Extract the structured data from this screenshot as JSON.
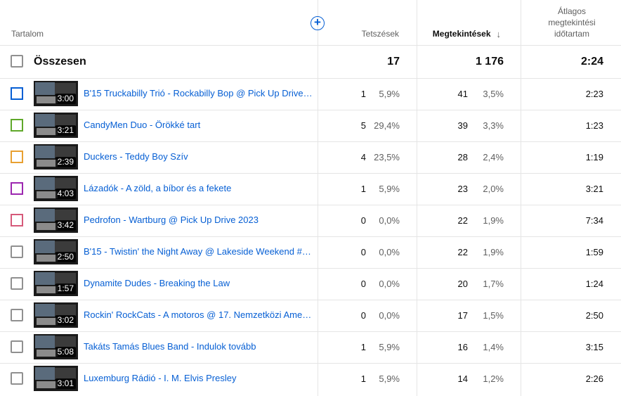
{
  "header": {
    "content": "Tartalom",
    "likes": "Tetszések",
    "views": "Megtekintések",
    "avg_line1": "Átlagos",
    "avg_line2": "megtekintési",
    "avg_line3": "időtartam",
    "add_icon": "plus-circle-icon",
    "sort_icon": "arrow-down-icon"
  },
  "total": {
    "label": "Összesen",
    "likes": "17",
    "views": "1 176",
    "avg": "2:24"
  },
  "rows": [
    {
      "color": "#065fd4",
      "duration": "3:00",
      "title": "B'15 Truckabilly Trió - Rockabilly Bop @ Pick Up Drive 2...",
      "likes": "1",
      "likes_pct": "5,9%",
      "views": "41",
      "views_pct": "3,5%",
      "avg": "2:23"
    },
    {
      "color": "#5fa82a",
      "duration": "3:21",
      "title": "CandyMen Duo - Örökké tart",
      "likes": "5",
      "likes_pct": "29,4%",
      "views": "39",
      "views_pct": "3,3%",
      "avg": "1:23"
    },
    {
      "color": "#e8a031",
      "duration": "2:39",
      "title": "Duckers - Teddy Boy Szív",
      "likes": "4",
      "likes_pct": "23,5%",
      "views": "28",
      "views_pct": "2,4%",
      "avg": "1:19"
    },
    {
      "color": "#9c27b0",
      "duration": "4:03",
      "title": "Lázadók - A zöld, a bíbor és a fekete",
      "likes": "1",
      "likes_pct": "5,9%",
      "views": "23",
      "views_pct": "2,0%",
      "avg": "3:21"
    },
    {
      "color": "#d65a7a",
      "duration": "3:42",
      "title": "Pedrofon - Wartburg @ Pick Up Drive 2023",
      "likes": "0",
      "likes_pct": "0,0%",
      "views": "22",
      "views_pct": "1,9%",
      "avg": "7:34"
    },
    {
      "color": null,
      "duration": "2:50",
      "title": "B'15 - Twistin' the Night Away @ Lakeside Weekend #2...",
      "likes": "0",
      "likes_pct": "0,0%",
      "views": "22",
      "views_pct": "1,9%",
      "avg": "1:59"
    },
    {
      "color": null,
      "duration": "1:57",
      "title": "Dynamite Dudes - Breaking the Law",
      "likes": "0",
      "likes_pct": "0,0%",
      "views": "20",
      "views_pct": "1,7%",
      "avg": "1:24"
    },
    {
      "color": null,
      "duration": "3:02",
      "title": "Rockin' RockCats - A motoros @ 17. Nemzetközi Ameri...",
      "likes": "0",
      "likes_pct": "0,0%",
      "views": "17",
      "views_pct": "1,5%",
      "avg": "2:50"
    },
    {
      "color": null,
      "duration": "5:08",
      "title": "Takáts Tamás Blues Band - Indulok tovább",
      "likes": "1",
      "likes_pct": "5,9%",
      "views": "16",
      "views_pct": "1,4%",
      "avg": "3:15"
    },
    {
      "color": null,
      "duration": "3:01",
      "title": "Luxemburg Rádió - I. M. Elvis Presley",
      "likes": "1",
      "likes_pct": "5,9%",
      "views": "14",
      "views_pct": "1,2%",
      "avg": "2:26"
    }
  ]
}
